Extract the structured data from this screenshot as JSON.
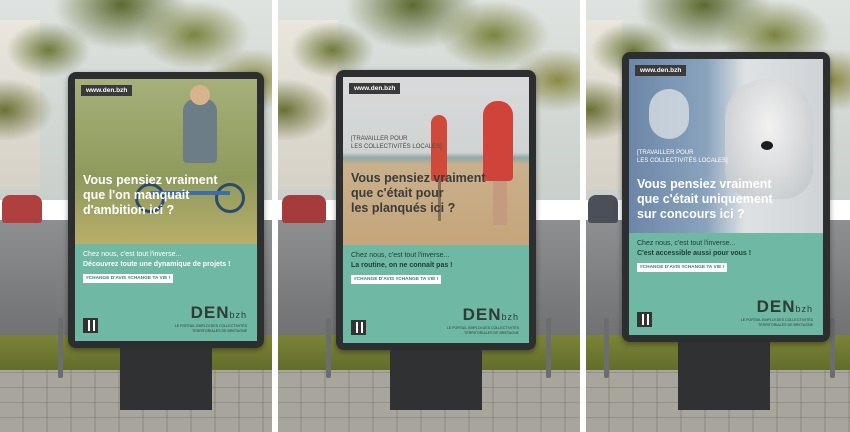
{
  "posters": [
    {
      "url": "www.den.bzh",
      "tag_line1": "",
      "tag_line2": "",
      "headline_line1": "Vous pensiez vraiment",
      "headline_line2": "que l'on manquait",
      "headline_line3": "d'ambition ici ?",
      "body_line1": "Chez nous, c'est tout l'inverse...",
      "body_line2": "Découvrez toute une dynamique de projets !",
      "hashtags": "#CHANGE D'AVIS #CHANGE TA VIE !",
      "logo": "DEN",
      "logo_suffix": "bzh",
      "logo_sub1": "LE PORTAIL EMPLOI DES COLLECTIVITÉS",
      "logo_sub2": "TERRITORIALES DE BRETAGNE"
    },
    {
      "url": "www.den.bzh",
      "tag_line1": "[TRAVAILLER POUR",
      "tag_line2": "LES COLLECTIVITÉS LOCALES]",
      "headline_line1": "Vous pensiez vraiment",
      "headline_line2": "que c'était pour",
      "headline_line3": "les planqués ici ?",
      "body_line1": "Chez nous, c'est tout l'inverse...",
      "body_line2": "La routine, on ne connaît pas !",
      "hashtags": "#CHANGE D'AVIS #CHANGE TA VIE !",
      "logo": "DEN",
      "logo_suffix": "bzh",
      "logo_sub1": "LE PORTAIL EMPLOI DES COLLECTIVITÉS",
      "logo_sub2": "TERRITORIALES DE BRETAGNE"
    },
    {
      "url": "www.den.bzh",
      "tag_line1": "[TRAVAILLER POUR",
      "tag_line2": "LES COLLECTIVITÉS LOCALES]",
      "headline_line1": "Vous pensiez vraiment",
      "headline_line2": "que c'était uniquement",
      "headline_line3": "sur concours ici ?",
      "body_line1": "Chez nous, c'est tout l'inverse...",
      "body_line2": "C'est accessible aussi pour vous !",
      "hashtags": "#CHANGE D'AVIS #CHANGE TA VIE !",
      "logo": "DEN",
      "logo_suffix": "bzh",
      "logo_sub1": "LE PORTAIL EMPLOI DES COLLECTIVITÉS",
      "logo_sub2": "TERRITORIALES DE BRETAGNE"
    }
  ],
  "colors": {
    "teal": "#6fb8a3",
    "kiosk_frame": "#2c2e30",
    "foliage": "#6f7a3c"
  }
}
